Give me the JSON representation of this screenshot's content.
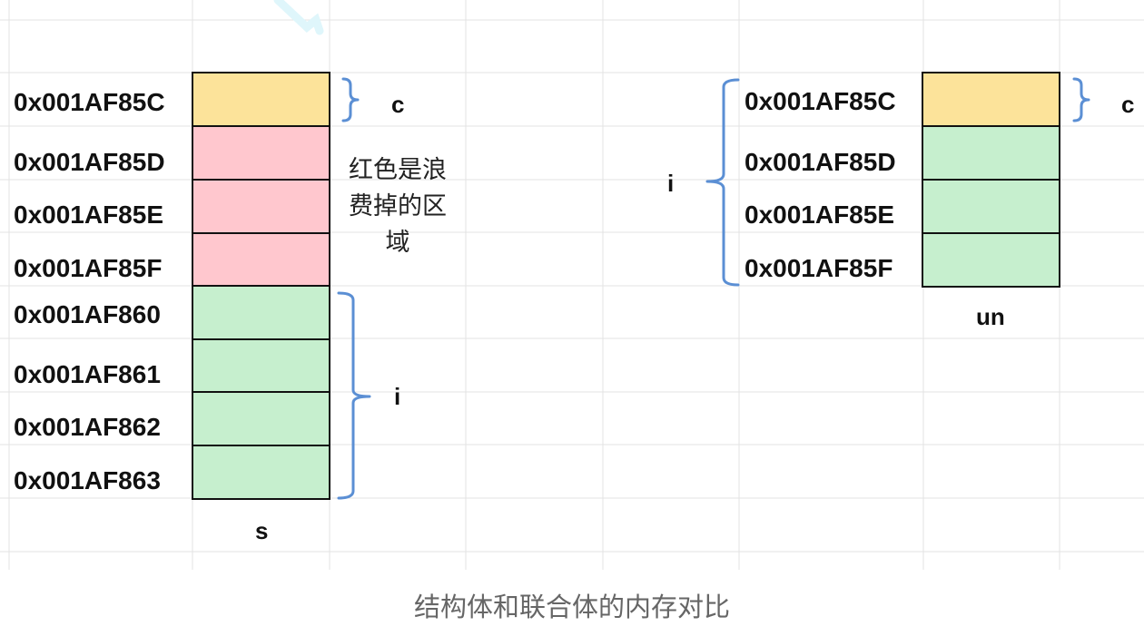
{
  "struct": {
    "addresses": [
      "0x001AF85C",
      "0x001AF85D",
      "0x001AF85E",
      "0x001AF85F",
      "0x001AF860",
      "0x001AF861",
      "0x001AF862",
      "0x001AF863"
    ],
    "label": "s",
    "member_c": "c",
    "member_i": "i",
    "note_lines": [
      "红色是浪",
      "费掉的区",
      "域"
    ]
  },
  "union": {
    "addresses": [
      "0x001AF85C",
      "0x001AF85D",
      "0x001AF85E",
      "0x001AF85F"
    ],
    "label": "un",
    "member_c": "c",
    "member_i": "i"
  },
  "caption": "结构体和联合体的内存对比",
  "colors": {
    "yellow": "#fce39a",
    "red": "#ffc7ce",
    "green": "#c6efce",
    "brace": "#5b8fd4",
    "grid": "#e3e3e3"
  }
}
